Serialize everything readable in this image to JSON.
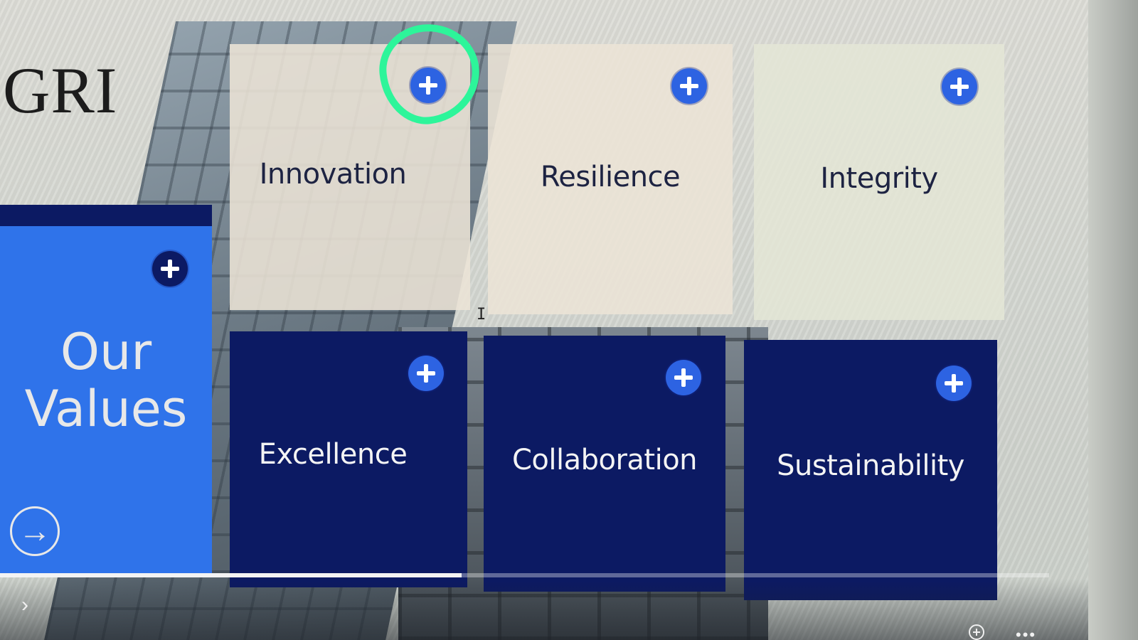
{
  "slide": {
    "logo_text": "GRI",
    "title": "Our\nValues",
    "values": [
      {
        "label": "Innovation"
      },
      {
        "label": "Resilience"
      },
      {
        "label": "Integrity"
      },
      {
        "label": "Excellence"
      },
      {
        "label": "Collaboration"
      },
      {
        "label": "Sustainability"
      }
    ],
    "progress": 0.44
  },
  "icons": {
    "plus": "plus-circle-icon",
    "arrow": "arrow-right-circle-icon",
    "next": "chevron-right-icon",
    "zoom": "zoom-in-icon",
    "more": "more-icon"
  },
  "colors": {
    "highlight": "#2df59a",
    "accent_blue": "#2f73ea",
    "navy": "#0c1a63",
    "plus_blue": "#2d63e2"
  }
}
